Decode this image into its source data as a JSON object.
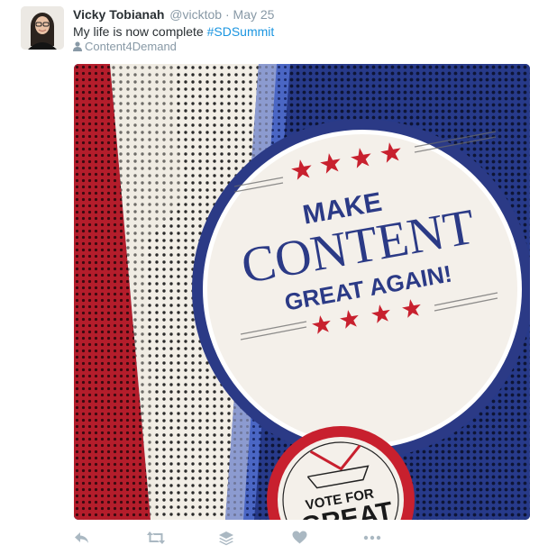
{
  "tweet": {
    "fullname": "Vicky Tobianah",
    "handle": "@vicktob",
    "separator": "·",
    "time": "May 25",
    "text": "My life is now complete",
    "hashtag": "#SDSummit",
    "place": "Content4Demand"
  },
  "media": {
    "badge": {
      "line1": "MAKE",
      "line2": "CONTENT",
      "line3": "GREAT AGAIN!"
    },
    "second_badge": {
      "line1": "VOTE FOR",
      "line2": "GREAT"
    }
  },
  "actions": [
    "reply-icon",
    "retweet-icon",
    "layers-icon",
    "like-icon",
    "more-icon"
  ],
  "colors": {
    "link": "#1b95e0",
    "muted": "#8899a6",
    "icon": "#aab8c2",
    "poster_red": "#c8202e",
    "poster_blue": "#2b3a86"
  }
}
